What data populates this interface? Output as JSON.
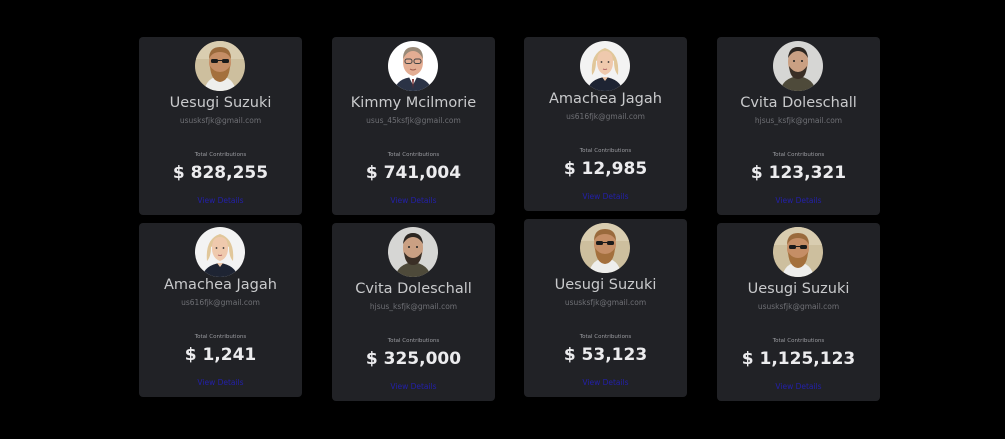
{
  "contributors": [
    {
      "name": "Uesugi Suzuki",
      "email": "ususksfjk@gmail.com",
      "total_label": "Total Contributions",
      "amount": "$ 828,255",
      "link": "View Details",
      "avatar": "bearded-man-sunglasses-avatar"
    },
    {
      "name": "Kimmy Mcilmorie",
      "email": "usus_45ksfjk@gmail.com",
      "total_label": "Total Contributions",
      "amount": "$ 741,004",
      "link": "View Details",
      "avatar": "man-glasses-suit-avatar"
    },
    {
      "name": "Amachea Jagah",
      "email": "us616fjk@gmail.com",
      "total_label": "Total Contributions",
      "amount": "$ 12,985",
      "link": "View Details",
      "avatar": "blonde-woman-avatar"
    },
    {
      "name": "Cvita Doleschall",
      "email": "hjsus_ksfjk@gmail.com",
      "total_label": "Total Contributions",
      "amount": "$ 123,321",
      "link": "View Details",
      "avatar": "bearded-man-avatar"
    },
    {
      "name": "Amachea Jagah",
      "email": "us616fjk@gmail.com",
      "total_label": "Total Contributions",
      "amount": "$ 1,241",
      "link": "View Details",
      "avatar": "blonde-woman-avatar"
    },
    {
      "name": "Cvita Doleschall",
      "email": "hjsus_ksfjk@gmail.com",
      "total_label": "Total Contributions",
      "amount": "$ 325,000",
      "link": "View Details",
      "avatar": "bearded-man-avatar"
    },
    {
      "name": "Uesugi Suzuki",
      "email": "ususksfjk@gmail.com",
      "total_label": "Total Contributions",
      "amount": "$ 53,123",
      "link": "View Details",
      "avatar": "bearded-man-sunglasses-avatar"
    },
    {
      "name": "Uesugi Suzuki",
      "email": "ususksfjk@gmail.com",
      "total_label": "Total Contributions",
      "amount": "$ 1,125,123",
      "link": "View Details",
      "avatar": "bearded-man-sunglasses-avatar"
    }
  ],
  "colors": {
    "background": "#000000",
    "card": "#212226",
    "name": "#c9cacc",
    "email": "#6f7075",
    "amount": "#ececee",
    "link": "#2320a8"
  }
}
